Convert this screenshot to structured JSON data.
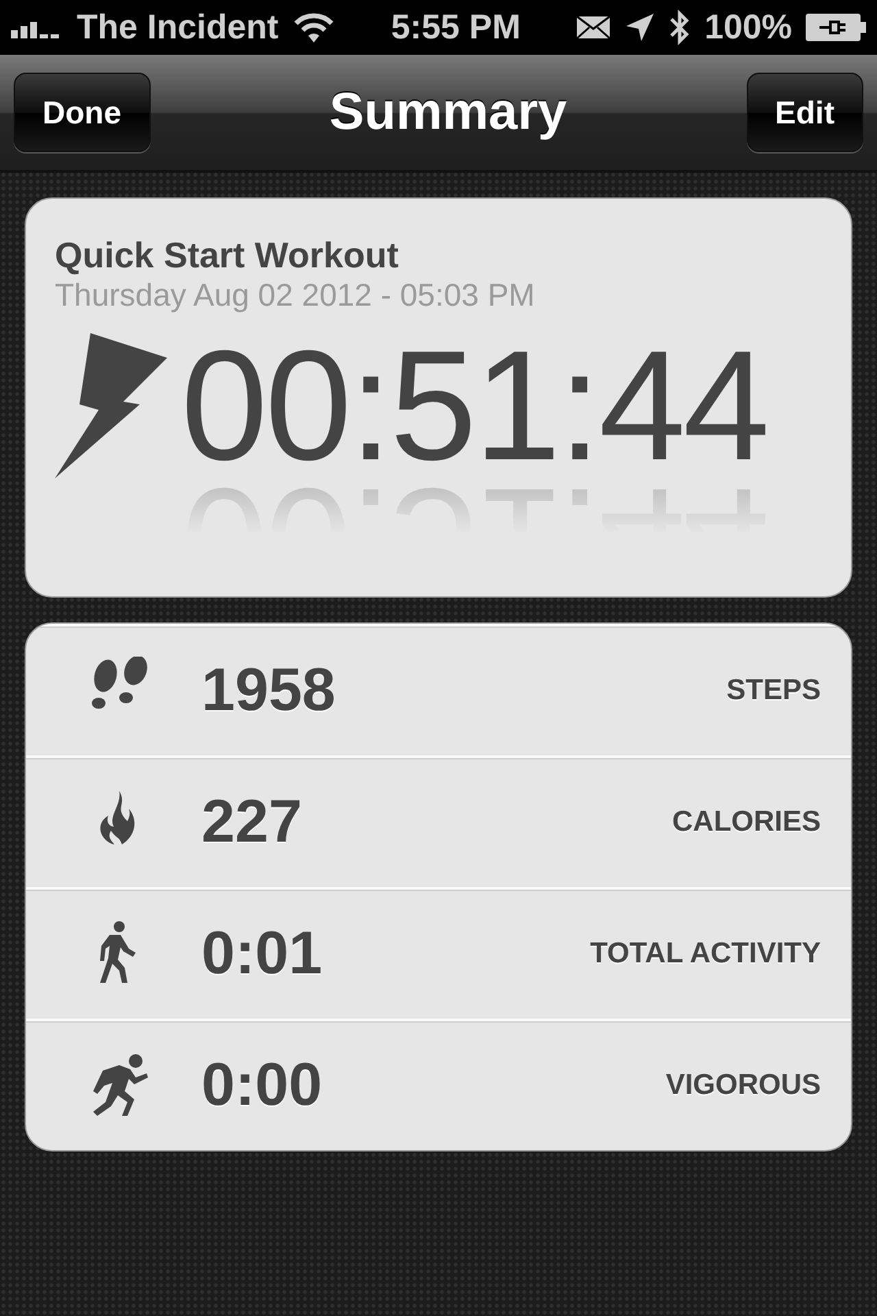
{
  "status_bar": {
    "carrier": "The Incident",
    "time": "5:55 PM",
    "battery": "100%"
  },
  "nav": {
    "title": "Summary",
    "left_button": "Done",
    "right_button": "Edit"
  },
  "workout": {
    "title": "Quick Start Workout",
    "date": "Thursday Aug 02 2012 - 05:03 PM",
    "duration": "00:51:44"
  },
  "stats": [
    {
      "kind": "steps",
      "value": "1958",
      "label": "STEPS"
    },
    {
      "kind": "calories",
      "value": "227",
      "label": "CALORIES"
    },
    {
      "kind": "activity",
      "value": "0:01",
      "label": "TOTAL ACTIVITY"
    },
    {
      "kind": "vigorous",
      "value": "0:00",
      "label": "VIGOROUS"
    }
  ]
}
